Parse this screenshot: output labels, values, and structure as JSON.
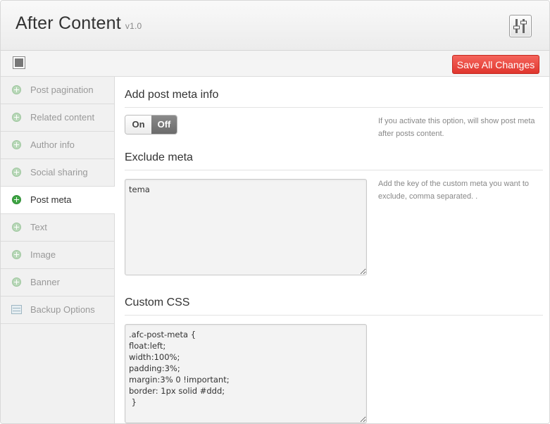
{
  "header": {
    "title": "After Content",
    "version": "v1.0",
    "logo_icon": "sliders-icon"
  },
  "toolbar": {
    "expand_icon": "expand-icon",
    "save_label": "Save All Changes",
    "save_color": "#e8453c"
  },
  "sidebar": {
    "items": [
      {
        "label": "Post pagination",
        "icon": "plus-circle-icon",
        "active": false
      },
      {
        "label": "Related content",
        "icon": "plus-circle-icon",
        "active": false
      },
      {
        "label": "Author info",
        "icon": "plus-circle-icon",
        "active": false
      },
      {
        "label": "Social sharing",
        "icon": "plus-circle-icon",
        "active": false
      },
      {
        "label": "Post meta",
        "icon": "plus-circle-icon",
        "active": true
      },
      {
        "label": "Text",
        "icon": "plus-circle-icon",
        "active": false
      },
      {
        "label": "Image",
        "icon": "plus-circle-icon",
        "active": false
      },
      {
        "label": "Banner",
        "icon": "plus-circle-icon",
        "active": false
      },
      {
        "label": "Backup Options",
        "icon": "backup-icon",
        "active": false
      }
    ]
  },
  "main": {
    "post_meta": {
      "title": "Add post meta info",
      "toggle_on": "On",
      "toggle_off": "Off",
      "toggle_state": "Off",
      "description": "If you activate this option, will show post meta after posts content."
    },
    "exclude_meta": {
      "title": "Exclude meta",
      "value": "tema",
      "description": "Add the key of the custom meta you want to exclude, comma separated. ."
    },
    "custom_css": {
      "title": "Custom CSS",
      "value": ".afc-post-meta {\nfloat:left;\nwidth:100%;\npadding:3%;\nmargin:3% 0 !important;\nborder: 1px solid #ddd;\n }"
    }
  }
}
